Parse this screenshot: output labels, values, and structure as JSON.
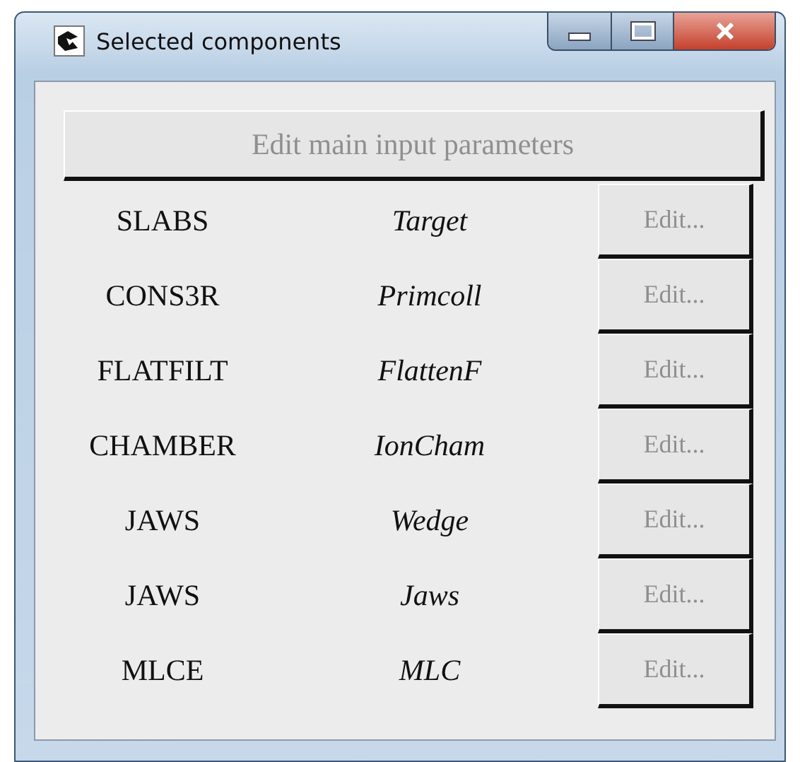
{
  "window": {
    "title": "Selected components"
  },
  "main_button": {
    "label": "Edit main input parameters",
    "disabled": true
  },
  "components": [
    {
      "module": "SLABS",
      "name": "Target",
      "edit_label": "Edit...",
      "disabled": true
    },
    {
      "module": "CONS3R",
      "name": "Primcoll",
      "edit_label": "Edit...",
      "disabled": true
    },
    {
      "module": "FLATFILT",
      "name": "FlattenF",
      "edit_label": "Edit...",
      "disabled": true
    },
    {
      "module": "CHAMBER",
      "name": "IonCham",
      "edit_label": "Edit...",
      "disabled": true
    },
    {
      "module": "JAWS",
      "name": "Wedge",
      "edit_label": "Edit...",
      "disabled": true
    },
    {
      "module": "JAWS",
      "name": "Jaws",
      "edit_label": "Edit...",
      "disabled": true
    },
    {
      "module": "MLCE",
      "name": "MLC",
      "edit_label": "Edit...",
      "disabled": true
    }
  ]
}
